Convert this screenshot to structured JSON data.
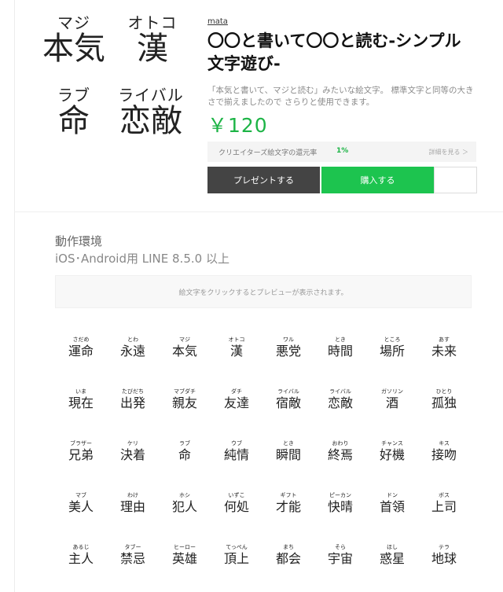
{
  "product": {
    "thumbnail": [
      {
        "ruby": "マジ",
        "kanji": "本気"
      },
      {
        "ruby": "オトコ",
        "kanji": "漢"
      },
      {
        "ruby": "ラブ",
        "kanji": "命"
      },
      {
        "ruby": "ライバル",
        "kanji": "恋敵"
      }
    ],
    "author": "mata",
    "title": "〇〇と書いて〇〇と読む-シンプル文字遊び-",
    "description": "「本気と書いて、マジと読む」みたいな絵文字。 標準文字と同等の大きさで揃えましたので さらりと使用できます。",
    "price": "￥120",
    "creator_rate_label": "クリエイターズ絵文字の還元率",
    "creator_rate_value": "1%",
    "details_link": "詳細を見る ＞",
    "gift_button": "プレゼントする",
    "buy_button": "購入する"
  },
  "environment": {
    "label": "動作環境",
    "value": "iOS･Android用 LINE 8.5.0 以上"
  },
  "preview_hint": "絵文字をクリックするとプレビューが表示されます。",
  "emoji": [
    {
      "ruby": "さだめ",
      "kanji": "運命"
    },
    {
      "ruby": "とわ",
      "kanji": "永遠"
    },
    {
      "ruby": "マジ",
      "kanji": "本気"
    },
    {
      "ruby": "オトコ",
      "kanji": "漢"
    },
    {
      "ruby": "ワル",
      "kanji": "悪党"
    },
    {
      "ruby": "とき",
      "kanji": "時間"
    },
    {
      "ruby": "ところ",
      "kanji": "場所"
    },
    {
      "ruby": "あす",
      "kanji": "未来"
    },
    {
      "ruby": "いま",
      "kanji": "現在"
    },
    {
      "ruby": "たびだち",
      "kanji": "出発"
    },
    {
      "ruby": "マブダチ",
      "kanji": "親友"
    },
    {
      "ruby": "ダチ",
      "kanji": "友達"
    },
    {
      "ruby": "ライバル",
      "kanji": "宿敵"
    },
    {
      "ruby": "ライバル",
      "kanji": "恋敵"
    },
    {
      "ruby": "ガソリン",
      "kanji": "酒"
    },
    {
      "ruby": "ひとり",
      "kanji": "孤独"
    },
    {
      "ruby": "ブラザー",
      "kanji": "兄弟"
    },
    {
      "ruby": "ケリ",
      "kanji": "決着"
    },
    {
      "ruby": "ラブ",
      "kanji": "命"
    },
    {
      "ruby": "ウブ",
      "kanji": "純情"
    },
    {
      "ruby": "とき",
      "kanji": "瞬間"
    },
    {
      "ruby": "おわり",
      "kanji": "終焉"
    },
    {
      "ruby": "チャンス",
      "kanji": "好機"
    },
    {
      "ruby": "キス",
      "kanji": "接吻"
    },
    {
      "ruby": "マブ",
      "kanji": "美人"
    },
    {
      "ruby": "わけ",
      "kanji": "理由"
    },
    {
      "ruby": "ホシ",
      "kanji": "犯人"
    },
    {
      "ruby": "いずこ",
      "kanji": "何処"
    },
    {
      "ruby": "ギフト",
      "kanji": "才能"
    },
    {
      "ruby": "ピーカン",
      "kanji": "快晴"
    },
    {
      "ruby": "ドン",
      "kanji": "首領"
    },
    {
      "ruby": "ボス",
      "kanji": "上司"
    },
    {
      "ruby": "あるじ",
      "kanji": "主人"
    },
    {
      "ruby": "タブー",
      "kanji": "禁忌"
    },
    {
      "ruby": "ヒーロー",
      "kanji": "英雄"
    },
    {
      "ruby": "てっぺん",
      "kanji": "頂上"
    },
    {
      "ruby": "まち",
      "kanji": "都会"
    },
    {
      "ruby": "そら",
      "kanji": "宇宙"
    },
    {
      "ruby": "ほし",
      "kanji": "惑星"
    },
    {
      "ruby": "テラ",
      "kanji": "地球"
    }
  ]
}
